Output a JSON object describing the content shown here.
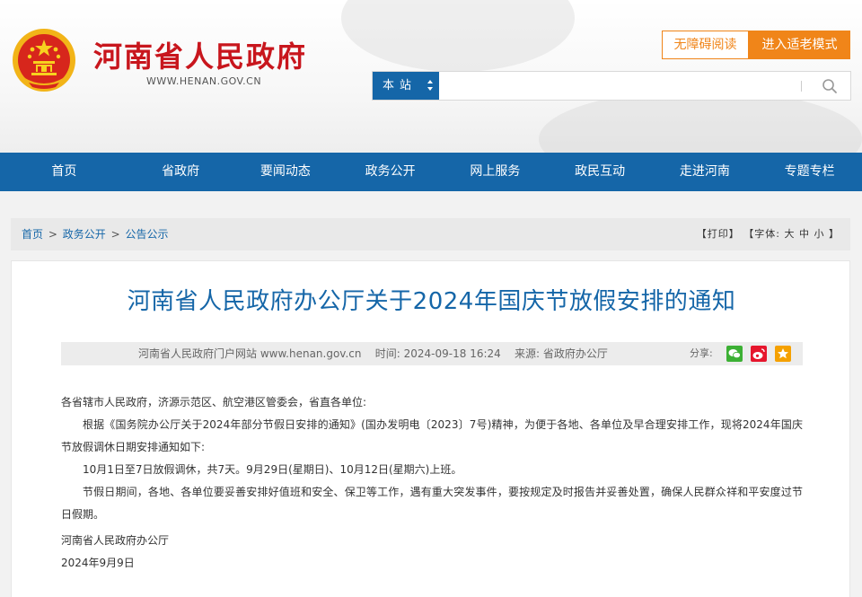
{
  "header": {
    "site_title": "河南省人民政府",
    "site_domain": "WWW.HENAN.GOV.CN",
    "accessibility_label": "无障碍阅读",
    "elder_mode_label": "进入适老模式"
  },
  "search": {
    "scope_label": "本站",
    "placeholder": "",
    "value": ""
  },
  "nav": {
    "items": [
      "首页",
      "省政府",
      "要闻动态",
      "政务公开",
      "网上服务",
      "政民互动",
      "走进河南",
      "专题专栏"
    ]
  },
  "breadcrumb": {
    "items": [
      "首页",
      "政务公开",
      "公告公示"
    ],
    "separator": ">"
  },
  "tools": {
    "print": "【打印】",
    "font_prefix": "【字体:",
    "font_large": "大",
    "font_medium": "中",
    "font_small": "小",
    "font_suffix": "】"
  },
  "article": {
    "title": "河南省人民政府办公厅关于2024年国庆节放假安排的通知",
    "source_site": "河南省人民政府门户网站 www.henan.gov.cn",
    "time_label": "时间:",
    "time_value": "2024-09-18 16:24",
    "origin_label": "来源:",
    "origin_value": "省政府办公厅",
    "share_label": "分享:",
    "salutation": "各省辖市人民政府，济源示范区、航空港区管委会，省直各单位:",
    "para1": "根据《国务院办公厅关于2024年部分节假日安排的通知》(国办发明电〔2023〕7号)精神，为便于各地、各单位及早合理安排工作，现将2024年国庆节放假调休日期安排通知如下:",
    "para2": "10月1日至7日放假调休，共7天。9月29日(星期日)、10月12日(星期六)上班。",
    "para3": "节假日期间，各地、各单位要妥善安排好值班和安全、保卫等工作，遇有重大突发事件，要按规定及时报告并妥善处置，确保人民群众祥和平安度过节日假期。",
    "signature": "河南省人民政府办公厅",
    "date": "2024年9月9日"
  },
  "colors": {
    "brand_red": "#c8161d",
    "nav_blue": "#1566a8",
    "accent_orange": "#f08519"
  }
}
